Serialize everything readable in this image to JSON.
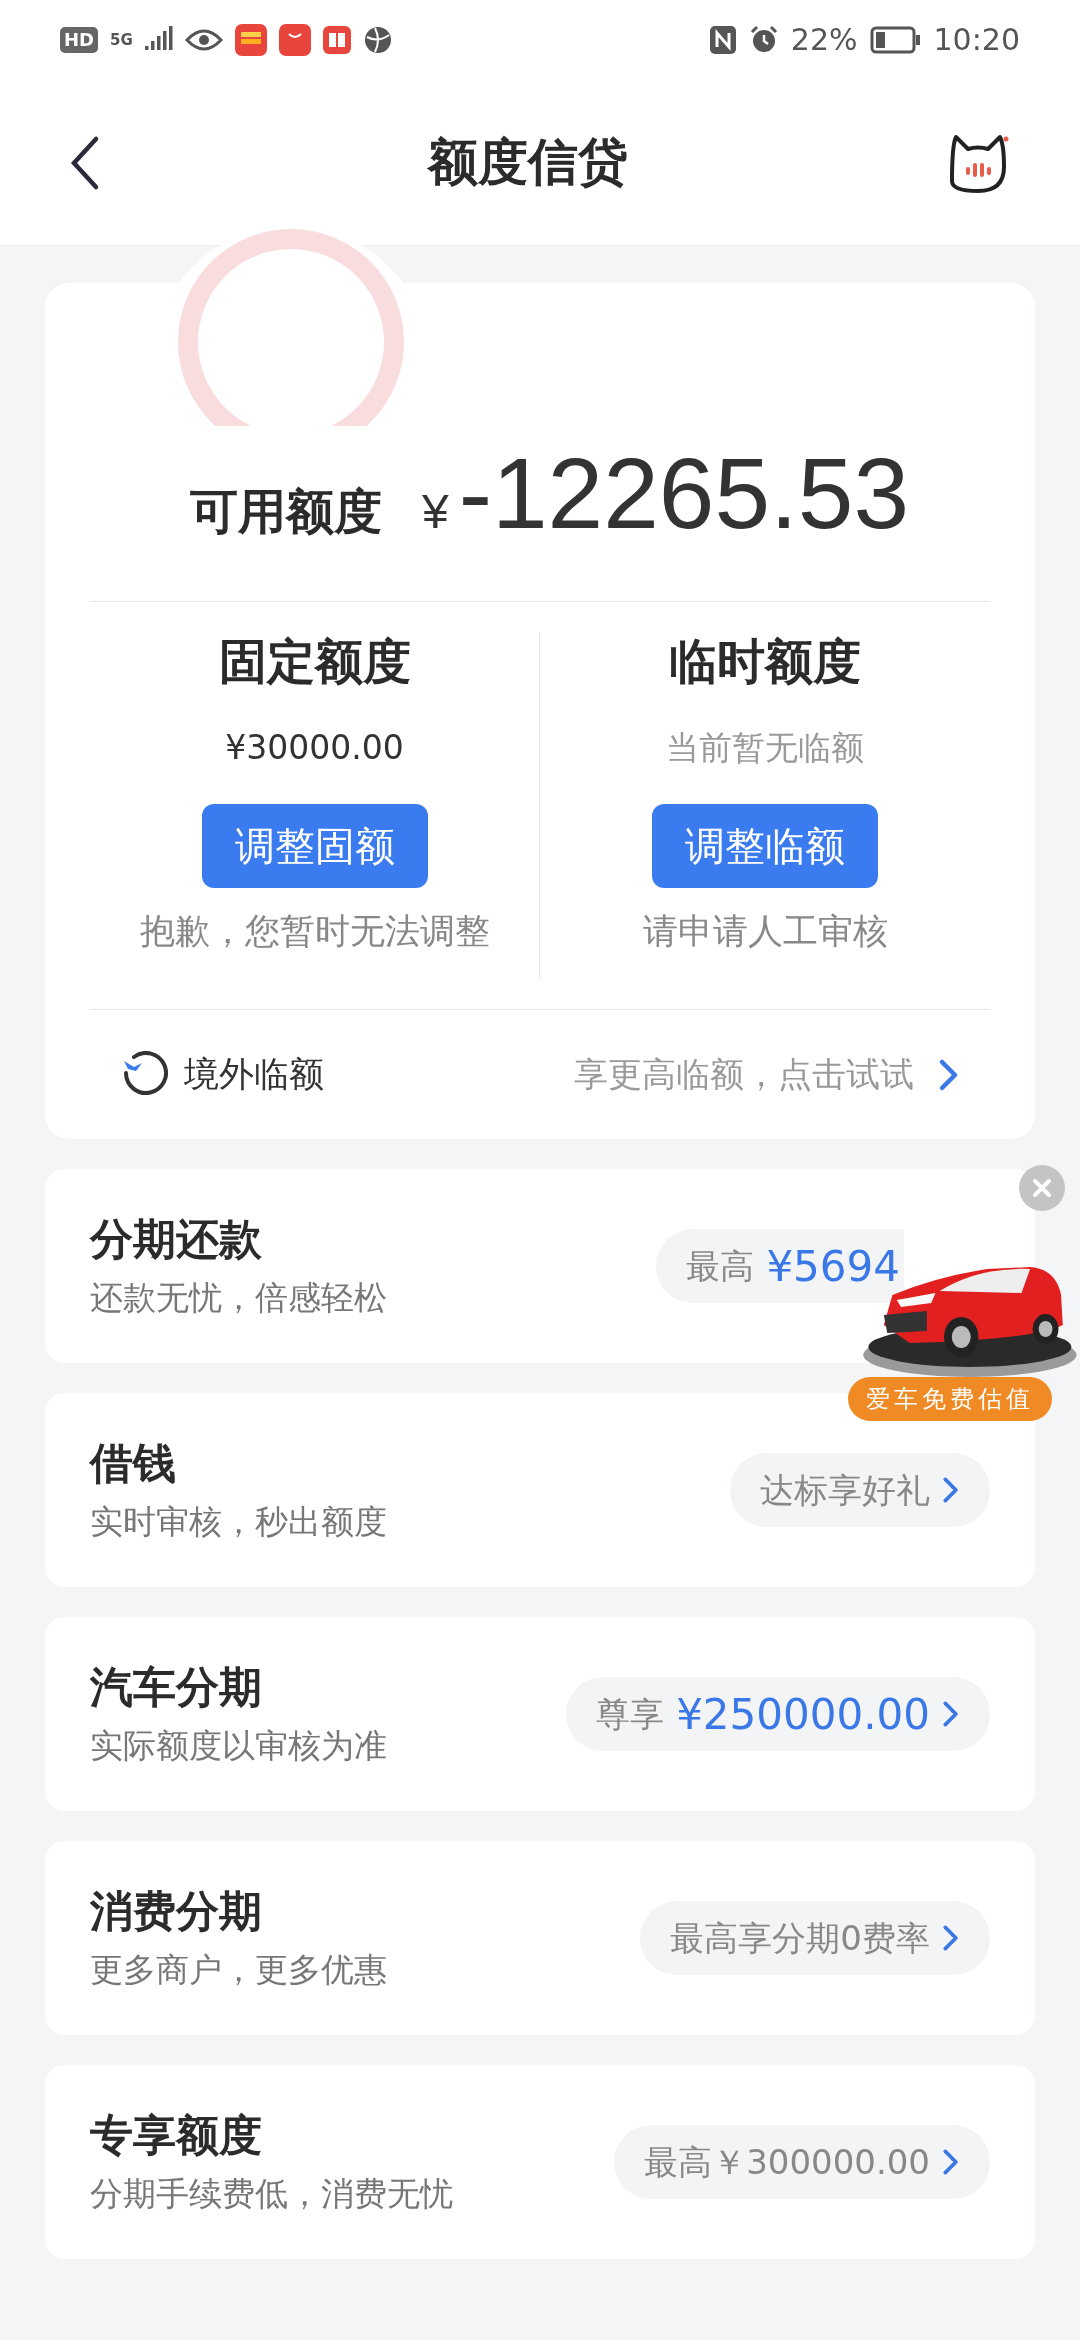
{
  "status_bar": {
    "hd": "HD",
    "network": "5G",
    "battery": "22%",
    "time": "10:20"
  },
  "header": {
    "title": "额度信贷"
  },
  "credit": {
    "label": "可用额度",
    "currency": "¥",
    "amount": "-12265.53",
    "columns": [
      {
        "title": "固定额度",
        "value": "¥30000.00",
        "kind": "amount",
        "button": "调整固额",
        "note": "抱歉，您暂时无法调整"
      },
      {
        "title": "临时额度",
        "value": "当前暂无临额",
        "kind": "text",
        "button": "调整临额",
        "note": "请申请人工审核"
      }
    ],
    "overseas": {
      "label": "境外临额",
      "action": "享更高临额，点击试试"
    }
  },
  "products": [
    {
      "title": "分期还款",
      "subtitle": "还款无忧，倍感轻松",
      "pill": {
        "kind": "amount",
        "prefix": "最高",
        "amount": "¥5694",
        "chevron": false
      }
    },
    {
      "title": "借钱",
      "subtitle": "实时审核，秒出额度",
      "pill": {
        "kind": "text",
        "text": "达标享好礼",
        "chevron": true
      }
    },
    {
      "title": "汽车分期",
      "subtitle": "实际额度以审核为准",
      "pill": {
        "kind": "amount",
        "prefix": "尊享",
        "amount": "¥250000.00",
        "chevron": true
      }
    },
    {
      "title": "消费分期",
      "subtitle": "更多商户，更多优惠",
      "pill": {
        "kind": "text",
        "text": "最高享分期0费率",
        "chevron": true
      }
    },
    {
      "title": "专享额度",
      "subtitle": "分期手续费低，消费无忧",
      "pill": {
        "kind": "text",
        "text": "最高￥300000.00",
        "chevron": true
      }
    }
  ],
  "ad": {
    "button": "爱车免费估值"
  }
}
